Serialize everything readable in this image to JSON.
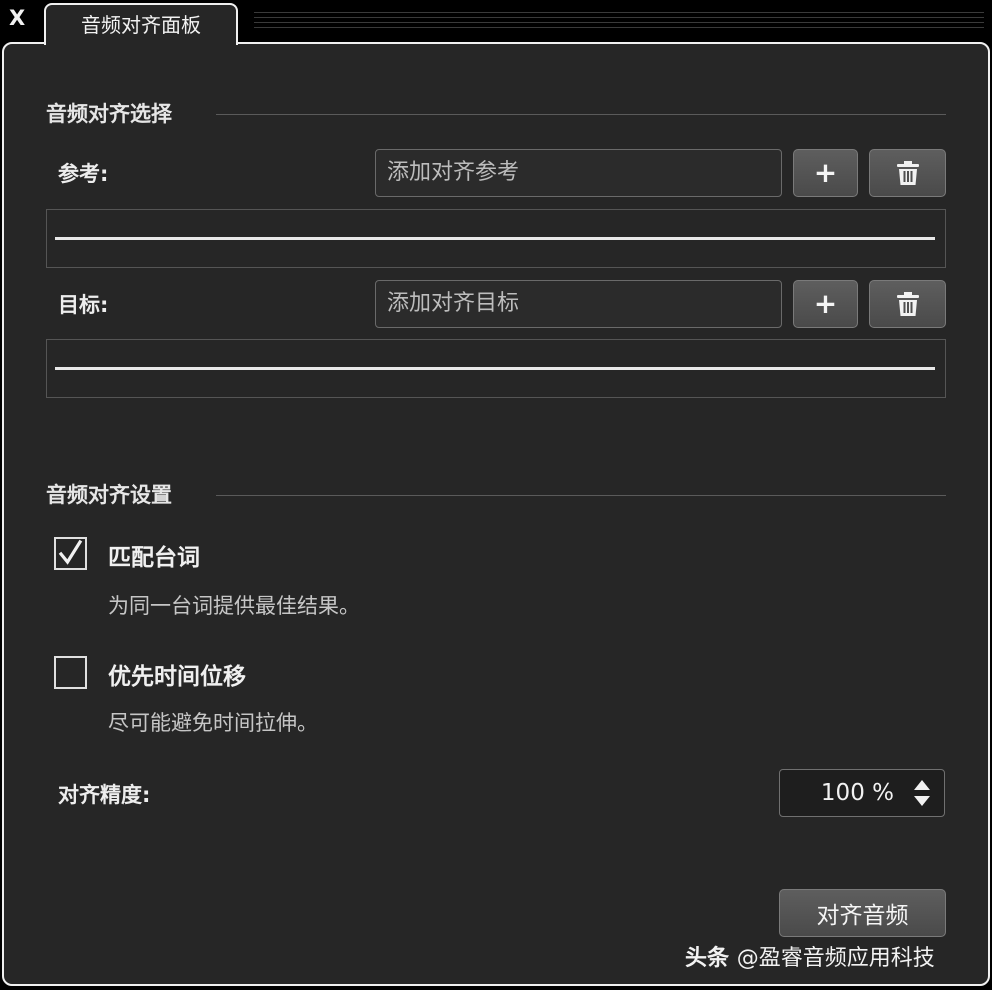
{
  "window": {
    "close_label": "X",
    "tab_title": "音频对齐面板"
  },
  "selection": {
    "title": "音频对齐选择",
    "reference": {
      "label": "参考:",
      "placeholder": "添加对齐参考"
    },
    "target": {
      "label": "目标:",
      "placeholder": "添加对齐目标"
    },
    "add_icon": "plus-icon",
    "delete_icon": "trash-icon"
  },
  "settings": {
    "title": "音频对齐设置",
    "match_dialogue": {
      "checked": true,
      "label": "匹配台词",
      "description": "为同一台词提供最佳结果。"
    },
    "prefer_time_shift": {
      "checked": false,
      "label": "优先时间位移",
      "description": "尽可能避免时间拉伸。"
    },
    "precision": {
      "label": "对齐精度:",
      "value": "100 %"
    }
  },
  "actions": {
    "align_label": "对齐音频"
  },
  "watermark": {
    "brand": "头条",
    "handle": "@盈睿音频应用科技"
  },
  "colors": {
    "panel_bg": "#262626",
    "border": "#f0f0f0",
    "button": "#555555"
  }
}
